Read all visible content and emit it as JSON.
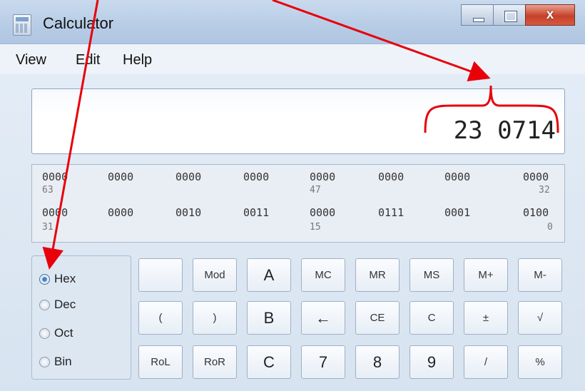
{
  "window": {
    "title": "Calculator",
    "close_glyph": "x"
  },
  "menu": [
    "View",
    "Edit",
    "Help"
  ],
  "display": {
    "value": "23 0714"
  },
  "bits": {
    "row1": [
      "0000",
      "0000",
      "0000",
      "0000",
      "0000",
      "0000",
      "0000",
      "0000"
    ],
    "row1_idx": [
      "63",
      "47",
      "32"
    ],
    "row2": [
      "0000",
      "0000",
      "0010",
      "0011",
      "0000",
      "0111",
      "0001",
      "0100"
    ],
    "row2_idx": [
      "31",
      "15",
      "0"
    ]
  },
  "radix": {
    "options": [
      "Hex",
      "Dec",
      "Oct",
      "Bin"
    ],
    "selected": "Hex"
  },
  "keys": {
    "row1": [
      "",
      "Mod",
      "A",
      "MC",
      "MR",
      "MS",
      "M+",
      "M-"
    ],
    "row2": [
      "(",
      ")",
      "B",
      "←",
      "CE",
      "C",
      "±",
      "√"
    ],
    "row3": [
      "RoL",
      "RoR",
      "C",
      "7",
      "8",
      "9",
      "/",
      "%"
    ]
  },
  "colors": {
    "annotation": "#e8000b",
    "accent_radio": "#3f86c9",
    "close_button": "#c7412a"
  }
}
